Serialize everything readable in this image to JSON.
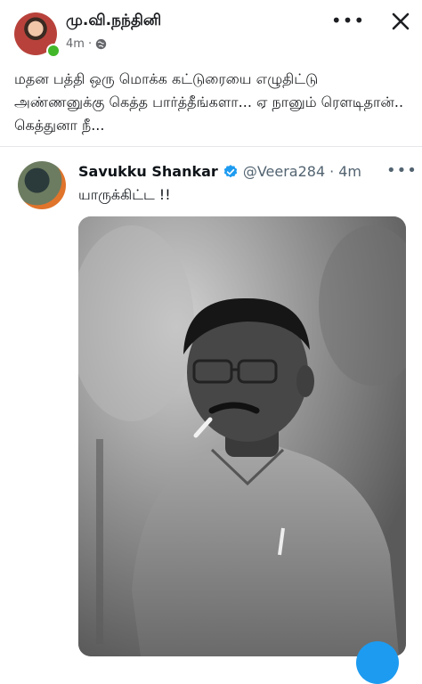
{
  "post": {
    "author": "மு.வி.நந்தினி",
    "time": "4m",
    "privacy_icon": "globe-icon",
    "text": "மதன பத்தி ஒரு மொக்க கட்டுரையை எழுதிட்டு அண்ணனுக்கு கெத்த பார்த்தீங்களா... ஏ நானும் ரௌடிதான்.. கெத்துனா நீ..."
  },
  "embed": {
    "name": "Savukku Shankar",
    "handle": "@Veera284",
    "sep": "·",
    "time": "4m",
    "text": "யாருக்கிட்ட !!"
  },
  "colors": {
    "online": "#42b72a",
    "verified": "#1d9bf0",
    "meta": "#65676b"
  }
}
